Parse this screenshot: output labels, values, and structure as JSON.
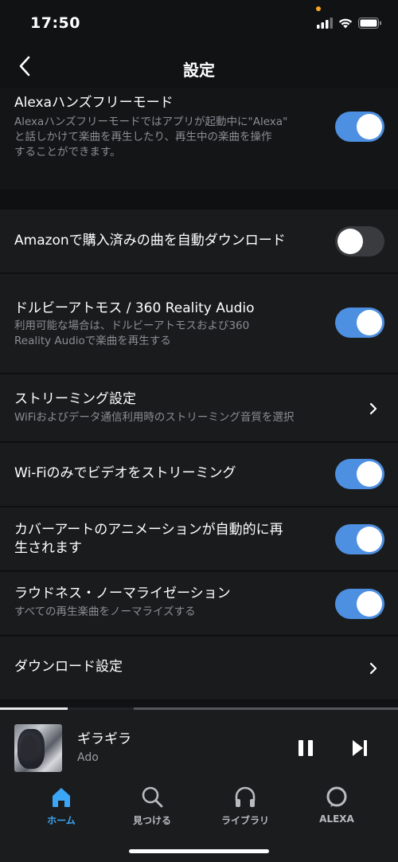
{
  "status": {
    "time": "17:50"
  },
  "nav": {
    "title": "設定"
  },
  "settings": [
    {
      "title": "Alexaハンズフリーモード",
      "subtitle_lines": [
        "Alexaハンズフリーモードではアプリが起動中に\"Alexa\"",
        "と話しかけて楽曲を再生したり、再生中の楽曲を操作",
        "することができます。"
      ],
      "toggle": "on"
    },
    {
      "title": "Amazonで購入済みの曲を自動ダウンロード",
      "toggle": "off"
    },
    {
      "title": "ドルビーアトモス / 360 Reality Audio",
      "subtitle_lines": [
        "利用可能な場合は、ドルビーアトモスおよび360",
        "Reality Audioで楽曲を再生する"
      ],
      "toggle": "on"
    },
    {
      "title": "ストリーミング設定",
      "subtitle_lines": [
        "WiFiおよびデータ通信利用時のストリーミング音質を選択"
      ],
      "chevron": true
    },
    {
      "title": "Wi-Fiのみでビデオをストリーミング",
      "toggle": "on"
    },
    {
      "title_lines": [
        "カバーアートのアニメーションが自動的に再",
        "生されます"
      ],
      "toggle": "on"
    },
    {
      "title": "ラウドネス・ノーマライゼーション",
      "subtitle_lines": [
        "すべての再生楽曲をノーマライズする"
      ],
      "toggle": "on"
    },
    {
      "title": "ダウンロード設定",
      "chevron": true
    }
  ],
  "player": {
    "track": "ギラギラ",
    "artist": "Ado",
    "progress": 0.17
  },
  "tabs": [
    {
      "label": "ホーム",
      "icon": "home-icon",
      "active": true
    },
    {
      "label": "見つける",
      "icon": "search-icon"
    },
    {
      "label": "ライブラリ",
      "icon": "headphones-icon"
    },
    {
      "label": "ALEXA",
      "icon": "alexa-icon"
    }
  ],
  "colors": {
    "accent": "#4d8fe0",
    "tab_active": "#3aa6f5",
    "background": "#111214"
  }
}
